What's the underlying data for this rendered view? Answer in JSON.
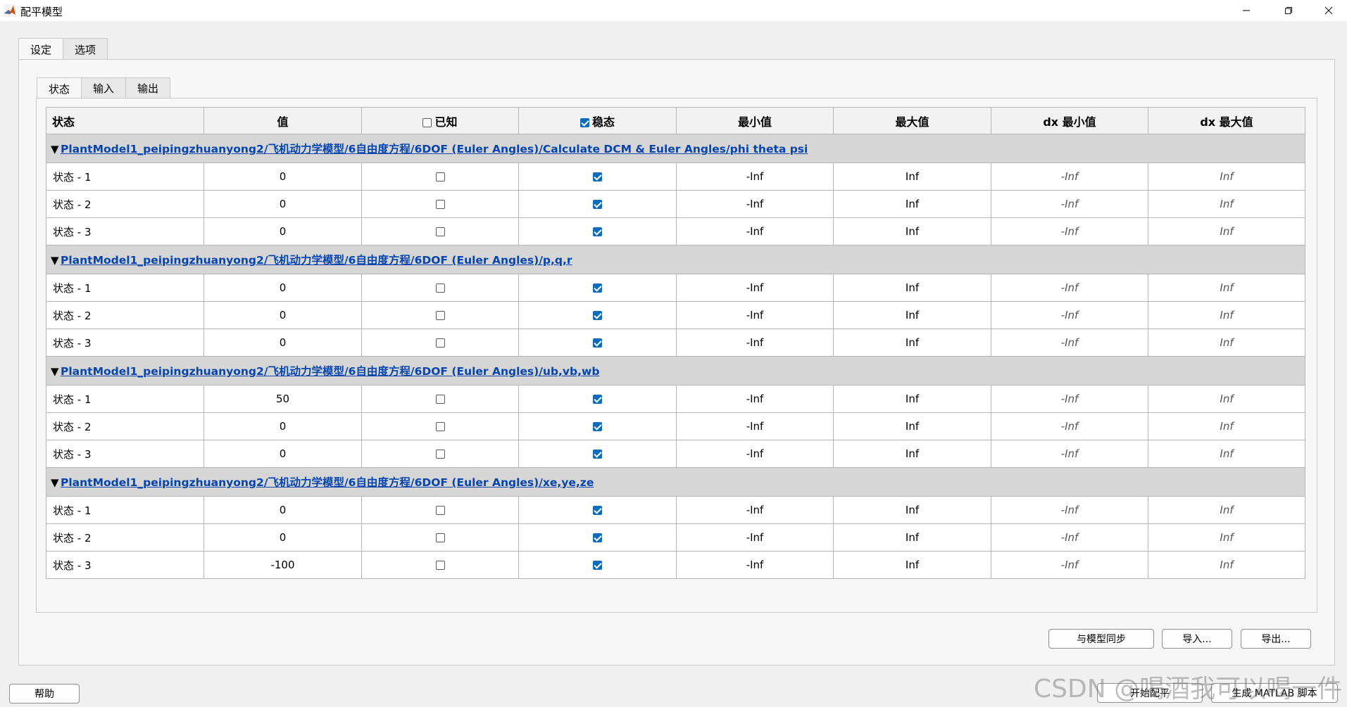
{
  "window": {
    "title": "配平模型"
  },
  "outer_tabs": [
    "设定",
    "选项"
  ],
  "inner_tabs": [
    "状态",
    "输入",
    "输出"
  ],
  "table": {
    "headers": {
      "name": "状态",
      "value": "值",
      "known": "已知",
      "steady": "稳态",
      "min": "最小值",
      "max": "最大值",
      "dxmin": "dx 最小值",
      "dxmax": "dx 最大值"
    },
    "groups": [
      {
        "path": "PlantModel1_peipingzhuanyong2/飞机动力学模型/6自由度方程/6DOF (Euler Angles)/Calculate DCM & Euler Angles/phi theta psi",
        "rows": [
          {
            "name": "状态 - 1",
            "value": "0",
            "known": false,
            "steady": true,
            "min": "-Inf",
            "max": "Inf",
            "dxmin": "-Inf",
            "dxmax": "Inf"
          },
          {
            "name": "状态 - 2",
            "value": "0",
            "known": false,
            "steady": true,
            "min": "-Inf",
            "max": "Inf",
            "dxmin": "-Inf",
            "dxmax": "Inf"
          },
          {
            "name": "状态 - 3",
            "value": "0",
            "known": false,
            "steady": true,
            "min": "-Inf",
            "max": "Inf",
            "dxmin": "-Inf",
            "dxmax": "Inf"
          }
        ]
      },
      {
        "path": "PlantModel1_peipingzhuanyong2/飞机动力学模型/6自由度方程/6DOF (Euler Angles)/p,q,r",
        "rows": [
          {
            "name": "状态 - 1",
            "value": "0",
            "known": false,
            "steady": true,
            "min": "-Inf",
            "max": "Inf",
            "dxmin": "-Inf",
            "dxmax": "Inf"
          },
          {
            "name": "状态 - 2",
            "value": "0",
            "known": false,
            "steady": true,
            "min": "-Inf",
            "max": "Inf",
            "dxmin": "-Inf",
            "dxmax": "Inf"
          },
          {
            "name": "状态 - 3",
            "value": "0",
            "known": false,
            "steady": true,
            "min": "-Inf",
            "max": "Inf",
            "dxmin": "-Inf",
            "dxmax": "Inf"
          }
        ]
      },
      {
        "path": "PlantModel1_peipingzhuanyong2/飞机动力学模型/6自由度方程/6DOF (Euler Angles)/ub,vb,wb",
        "rows": [
          {
            "name": "状态 - 1",
            "value": "50",
            "known": false,
            "steady": true,
            "min": "-Inf",
            "max": "Inf",
            "dxmin": "-Inf",
            "dxmax": "Inf"
          },
          {
            "name": "状态 - 2",
            "value": "0",
            "known": false,
            "steady": true,
            "min": "-Inf",
            "max": "Inf",
            "dxmin": "-Inf",
            "dxmax": "Inf"
          },
          {
            "name": "状态 - 3",
            "value": "0",
            "known": false,
            "steady": true,
            "min": "-Inf",
            "max": "Inf",
            "dxmin": "-Inf",
            "dxmax": "Inf"
          }
        ]
      },
      {
        "path": "PlantModel1_peipingzhuanyong2/飞机动力学模型/6自由度方程/6DOF (Euler Angles)/xe,ye,ze",
        "rows": [
          {
            "name": "状态 - 1",
            "value": "0",
            "known": false,
            "steady": true,
            "min": "-Inf",
            "max": "Inf",
            "dxmin": "-Inf",
            "dxmax": "Inf"
          },
          {
            "name": "状态 - 2",
            "value": "0",
            "known": false,
            "steady": true,
            "min": "-Inf",
            "max": "Inf",
            "dxmin": "-Inf",
            "dxmax": "Inf"
          },
          {
            "name": "状态 - 3",
            "value": "-100",
            "known": false,
            "steady": true,
            "min": "-Inf",
            "max": "Inf",
            "dxmin": "-Inf",
            "dxmax": "Inf"
          }
        ]
      }
    ]
  },
  "buttons": {
    "sync": "与模型同步",
    "import": "导入...",
    "export": "导出...",
    "help": "帮助",
    "start": "开始配平",
    "generate": "生成 MATLAB 脚本"
  },
  "watermark": "CSDN @喝酒我可以喝一件",
  "colors": {
    "link": "#0645ad",
    "checkbox": "#0f6cbd",
    "group_bg": "#d6d6d6"
  }
}
